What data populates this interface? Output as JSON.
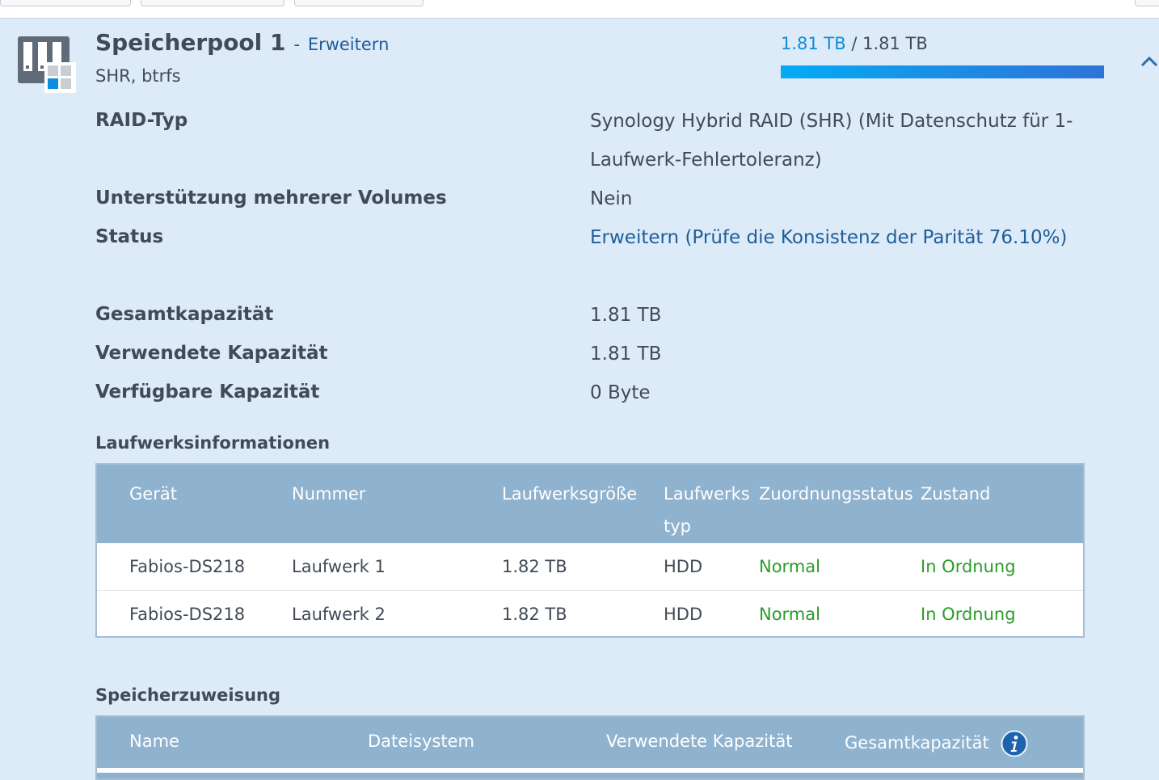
{
  "pool": {
    "title": "Speicherpool 1",
    "separator": "-",
    "action_label": "Erweitern",
    "subtitle": "SHR, btrfs",
    "capacity_used": "1.81 TB",
    "capacity_sep": "/",
    "capacity_total": "1.81 TB",
    "usage_fraction": 1.0
  },
  "info": [
    {
      "label": "RAID-Typ",
      "value": "Synology Hybrid RAID (SHR) (Mit Datenschutz für 1-Laufwerk-Fehlertoleranz)"
    },
    {
      "label": "Unterstützung mehrerer Volumes",
      "value": "Nein"
    },
    {
      "label": "Status",
      "value": "Erweitern (Prüfe die Konsistenz der Parität 76.10%)"
    },
    {
      "label": "Gesamtkapazität",
      "value": "1.81 TB"
    },
    {
      "label": "Verwendete Kapazität",
      "value": "1.81 TB"
    },
    {
      "label": "Verfügbare Kapazität",
      "value": "0 Byte"
    }
  ],
  "drives": {
    "title": "Laufwerksinformationen",
    "columns": [
      "Gerät",
      "Nummer",
      "Laufwerksgröße",
      "Laufwerks typ",
      "Zuordnungsstatus",
      "Zustand"
    ],
    "rows": [
      [
        "Fabios-DS218",
        "Laufwerk 1",
        "1.82 TB",
        "HDD",
        "Normal",
        "In Ordnung"
      ],
      [
        "Fabios-DS218",
        "Laufwerk 2",
        "1.82 TB",
        "HDD",
        "Normal",
        "In Ordnung"
      ]
    ]
  },
  "allocation": {
    "title": "Speicherzuweisung",
    "columns": [
      "Name",
      "Dateisystem",
      "Verwendete Kapazität",
      "Gesamtkapazität"
    ]
  },
  "icons": {
    "pool": "storage-pool-icon",
    "collapse": "chevron-up-icon",
    "info": "info-icon"
  },
  "colors": {
    "background": "#ddeaf8",
    "header": "#8fb2cf",
    "link": "#1d5e9a",
    "progress": "#0a8ee0",
    "healthy": "#2a9d2a"
  }
}
